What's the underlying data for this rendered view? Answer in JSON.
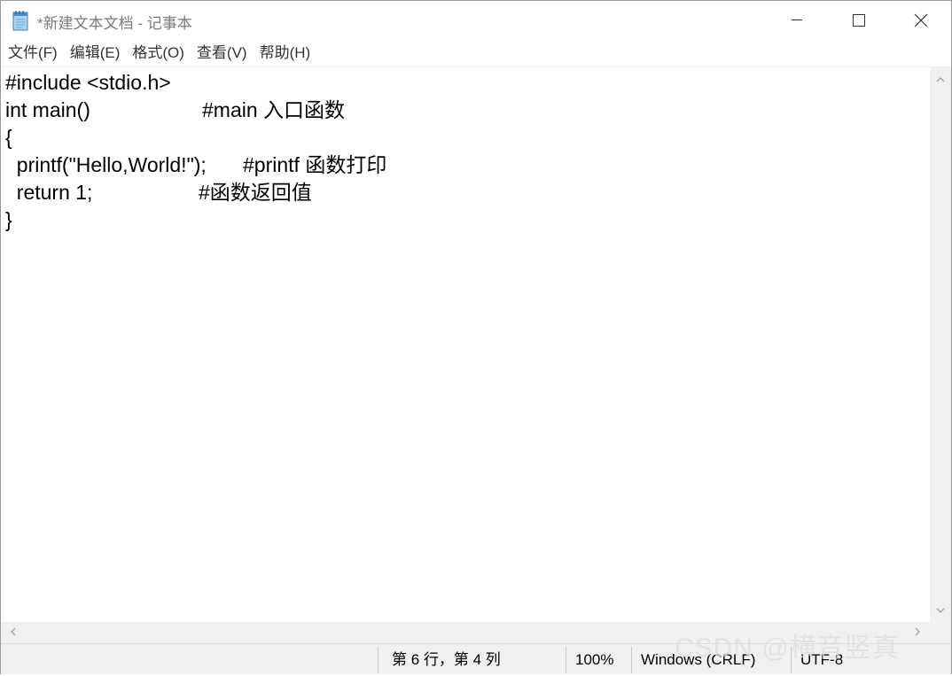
{
  "window": {
    "title": "*新建文本文档 - 记事本",
    "minimize_icon": "minimize-icon",
    "maximize_icon": "maximize-icon",
    "close_icon": "close-icon"
  },
  "menu": {
    "file": "文件(F)",
    "edit": "编辑(E)",
    "format": "格式(O)",
    "view": "查看(V)",
    "help": "帮助(H)"
  },
  "editor": {
    "lines": [
      {
        "code": "#include <stdio.h>",
        "comment": ""
      },
      {
        "code": "int main()",
        "comment": "#main 入口函数"
      },
      {
        "code": "{",
        "comment": ""
      },
      {
        "code": "  printf(\"Hello,World!\");",
        "comment": "#printf 函数打印"
      },
      {
        "code": "  return 1;",
        "comment": "#函数返回值"
      },
      {
        "code": "}",
        "comment": ""
      }
    ]
  },
  "status": {
    "position": "第 6 行，第 4 列",
    "zoom": "100%",
    "line_ending": "Windows (CRLF)",
    "encoding": "UTF-8"
  },
  "watermark": "CSDN @横音竖真",
  "colors": {
    "background": "#ffffff",
    "chrome": "#f0f0f0",
    "title_text": "#7a7a7a"
  }
}
